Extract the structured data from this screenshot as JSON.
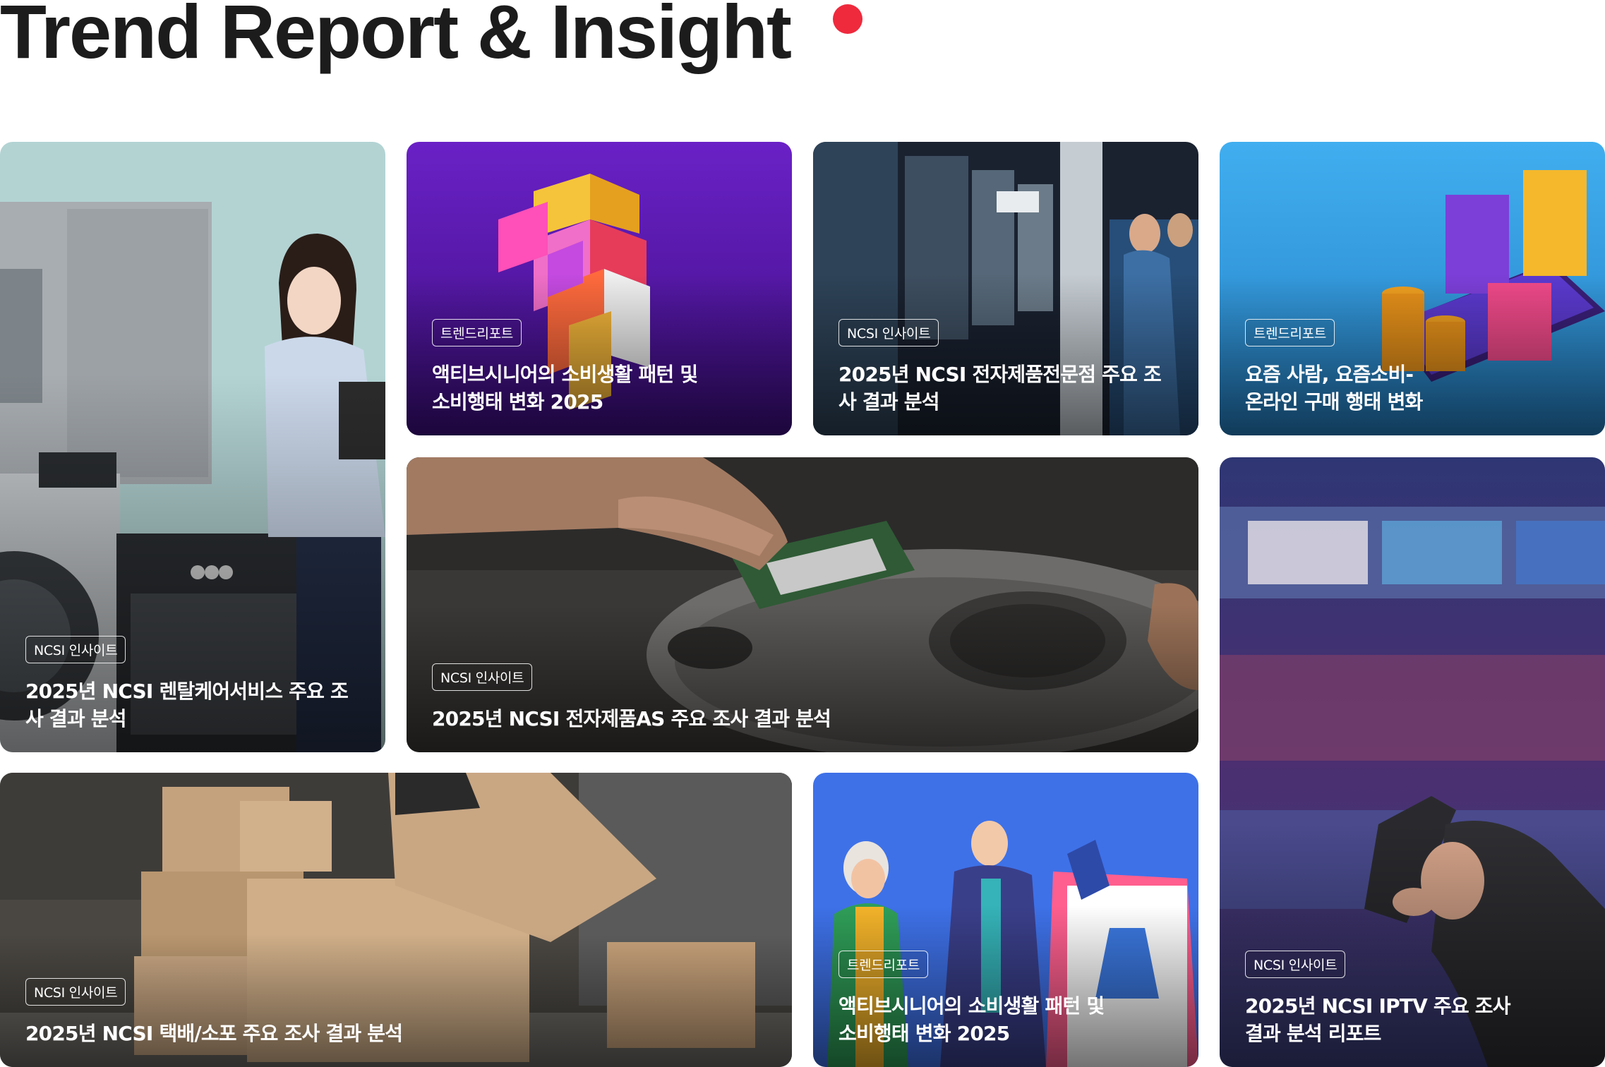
{
  "header": {
    "title": "Trend Report & Insight"
  },
  "colors": {
    "accent_dot": "#ef2a3d",
    "title": "#1c1c1c"
  },
  "cards": [
    {
      "badge": "NCSI 인사이트",
      "title": "2025년 NCSI 렌탈케어서비스 주요 조사 결과 분석",
      "image": "woman-with-appliances"
    },
    {
      "badge": "트렌드리포트",
      "title": "액티브시니어의 소비생활 패턴 및 소비행태 변화 2025",
      "image": "3d-puzzle-cube"
    },
    {
      "badge": "NCSI 인사이트",
      "title": "2025년 NCSI 전자제품전문점 주요 조사 결과 분석",
      "image": "electronics-store-shoppers"
    },
    {
      "badge": "트렌드리포트",
      "title": "요즘 사람, 요즘소비- 온라인 구매 행태 변화",
      "image": "shopping-bags-smartphone"
    },
    {
      "badge": "NCSI 인사이트",
      "title": "2025년 NCSI 전자제품AS 주요 조사 결과 분석",
      "image": "hand-installing-ram"
    },
    {
      "badge": "NCSI 인사이트",
      "title": "2025년 NCSI IPTV 주요 조사 결과 분석 리포트",
      "image": "remote-control-tv"
    },
    {
      "badge": "NCSI 인사이트",
      "title": "2025년 NCSI 택배/소포 주요 조사 결과 분석",
      "image": "parcel-boxes-warehouse"
    },
    {
      "badge": "트렌드리포트",
      "title": "액티브시니어의 소비생활 패턴 및 소비행태 변화 2025",
      "image": "seniors-online-shopping"
    }
  ]
}
